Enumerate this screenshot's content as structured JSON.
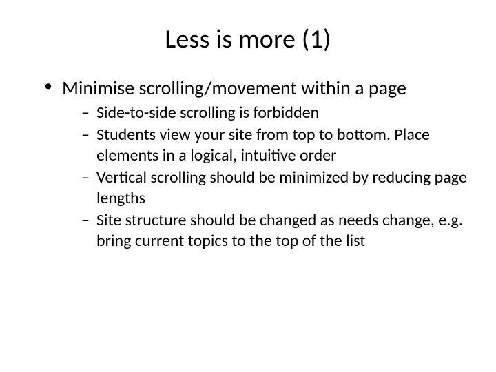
{
  "title": "Less is more (1)",
  "bullet1": "Minimise scrolling/movement within a page",
  "sub": [
    "Side-to-side scrolling is forbidden",
    "Students view your site from top to bottom. Place elements in a logical, intuitive order",
    "Vertical scrolling should be minimized by reducing page lengths",
    "Site structure should be changed as needs change, e.g. bring current topics to the top of the list"
  ]
}
